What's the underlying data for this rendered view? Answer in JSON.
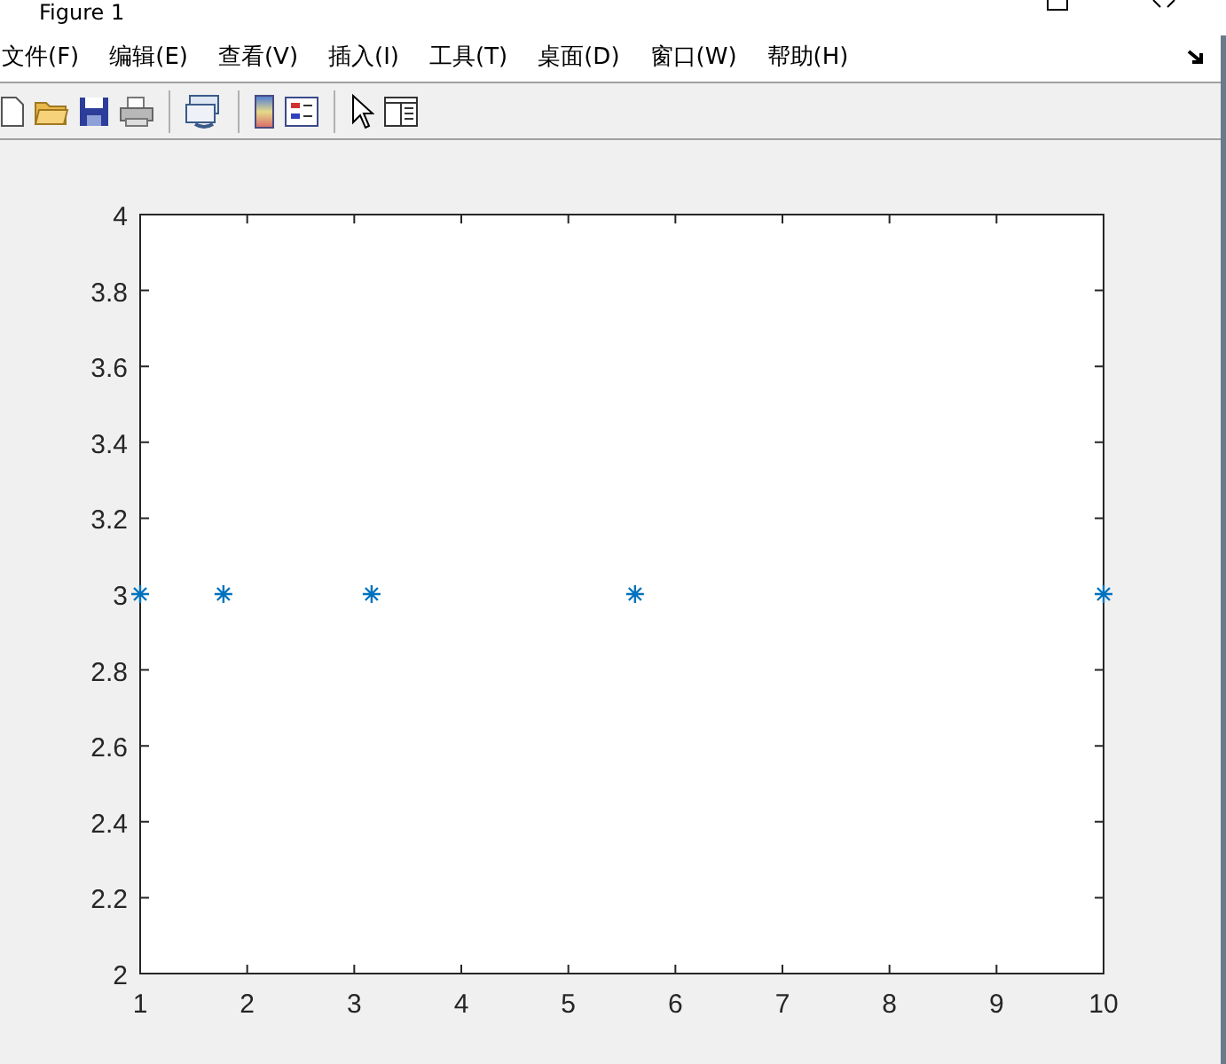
{
  "window": {
    "title": "Figure 1"
  },
  "menu": [
    {
      "label": "文件(F)"
    },
    {
      "label": "编辑(E)"
    },
    {
      "label": "查看(V)"
    },
    {
      "label": "插入(I)"
    },
    {
      "label": "工具(T)"
    },
    {
      "label": "桌面(D)"
    },
    {
      "label": "窗口(W)"
    },
    {
      "label": "帮助(H)"
    }
  ],
  "toolbar": [
    {
      "kind": "new"
    },
    {
      "kind": "open"
    },
    {
      "kind": "save"
    },
    {
      "kind": "print"
    },
    {
      "kind": "sep"
    },
    {
      "kind": "link"
    },
    {
      "kind": "sep"
    },
    {
      "kind": "colorbar"
    },
    {
      "kind": "legend"
    },
    {
      "kind": "sep"
    },
    {
      "kind": "pointer"
    },
    {
      "kind": "panel"
    }
  ],
  "plot": {
    "chart_data": {
      "type": "scatter",
      "x": [
        1,
        1.778,
        3.162,
        5.623,
        10
      ],
      "series": [
        {
          "color": "#0072bd",
          "values": [
            3,
            3,
            3,
            3,
            3
          ]
        }
      ],
      "xlim": [
        1,
        10
      ],
      "ylim": [
        2,
        4
      ],
      "xticks": [
        1,
        2,
        3,
        4,
        5,
        6,
        7,
        8,
        9,
        10
      ],
      "yticks": [
        {
          "value": 2,
          "label": "2"
        },
        {
          "value": 2.2,
          "label": "2.2"
        },
        {
          "value": 2.4,
          "label": "2.4"
        },
        {
          "value": 2.6,
          "label": "2.6"
        },
        {
          "value": 2.8,
          "label": "2.8"
        },
        {
          "value": 3,
          "label": "3"
        },
        {
          "value": 3.2,
          "label": "3.2"
        },
        {
          "value": 3.4,
          "label": "3.4"
        },
        {
          "value": 3.6,
          "label": "3.6"
        },
        {
          "value": 3.8,
          "label": "3.8"
        },
        {
          "value": 4,
          "label": "4"
        }
      ]
    }
  }
}
